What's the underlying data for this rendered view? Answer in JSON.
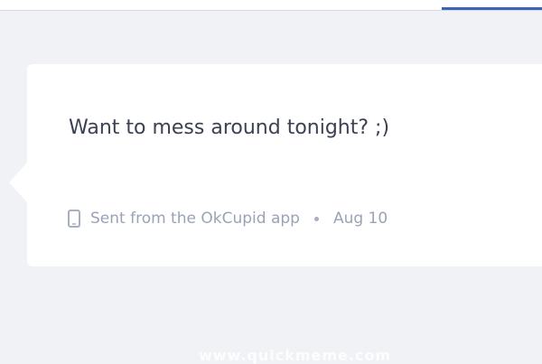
{
  "message": {
    "text": "Want to mess around tonight? ;)",
    "source": "Sent from the OkCupid app",
    "date": "Aug 10"
  },
  "icons": {
    "device": "phone-icon"
  },
  "colors": {
    "background": "#f1f2f6",
    "bubble": "#ffffff",
    "message_text": "#3c4152",
    "meta_text": "#9aa3b6",
    "accent": "#3c64b4"
  },
  "overlay": {
    "text": "www.quickmeme.com"
  }
}
